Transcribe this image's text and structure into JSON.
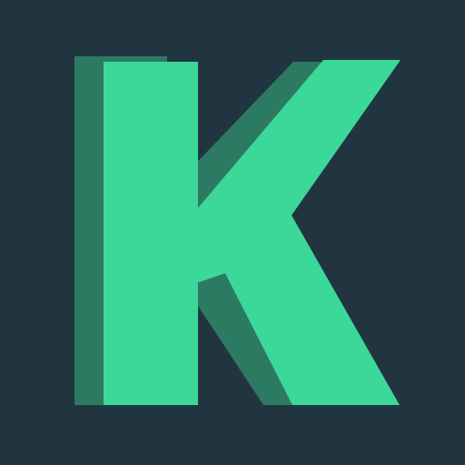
{
  "logo": {
    "letter": "K",
    "background_color": "#213540",
    "letter_color": "#3CD89A",
    "shadow_color": "#2C7A62",
    "style": "flat letter K with offset solid shadow"
  }
}
